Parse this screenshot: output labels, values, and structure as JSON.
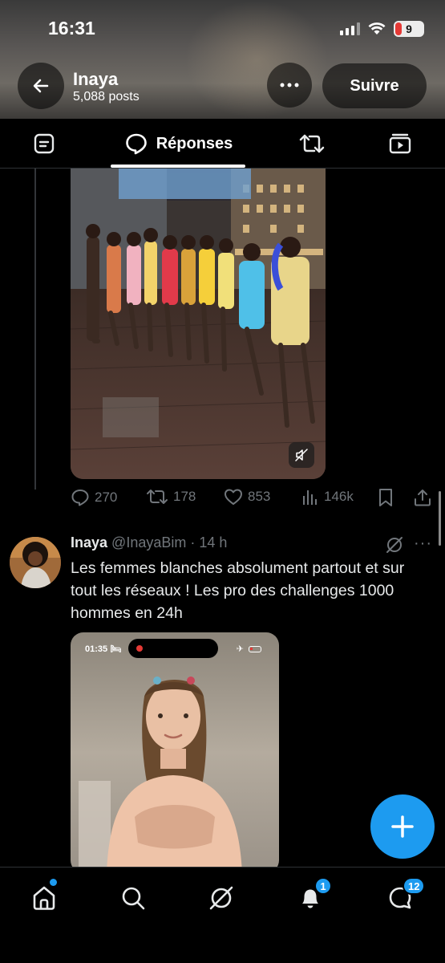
{
  "status_bar": {
    "time": "16:31",
    "battery": "9"
  },
  "profile": {
    "name": "Inaya",
    "posts": "5,088 posts",
    "follow_label": "Suivre",
    "more_label": "•••"
  },
  "tabs": [
    {
      "icon": "posts-icon",
      "label": ""
    },
    {
      "icon": "replies-icon",
      "label": "Réponses"
    },
    {
      "icon": "retweet-icon",
      "label": ""
    },
    {
      "icon": "media-icon",
      "label": ""
    }
  ],
  "tweet1": {
    "stats": {
      "replies": "270",
      "retweets": "178",
      "likes": "853",
      "views": "146k"
    }
  },
  "tweet2": {
    "name": "Inaya",
    "meta": "@InayaBim · 14 h",
    "more": "···",
    "text": "Les femmes blanches absolument partout et sur tout les réseaux ! Les pro des challenges 1000 hommes en 24h",
    "phone_time": "01:35"
  },
  "bottom_nav": {
    "notifications_count": "1",
    "messages_count": "12"
  },
  "colors": {
    "accent": "#1d9bf0",
    "muted": "#71767b",
    "text": "#e7e9ea"
  }
}
